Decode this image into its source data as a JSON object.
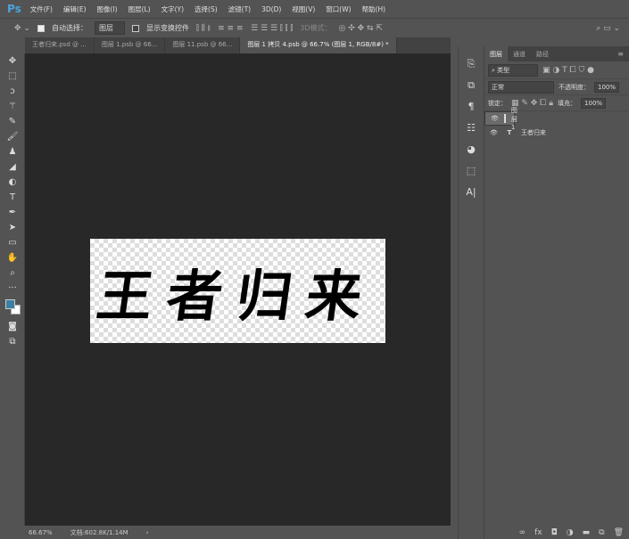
{
  "app": {
    "logo": "Ps"
  },
  "menu": [
    "文件(F)",
    "编辑(E)",
    "图像(I)",
    "图层(L)",
    "文字(Y)",
    "选择(S)",
    "滤镜(T)",
    "3D(D)",
    "视图(V)",
    "窗口(W)",
    "帮助(H)"
  ],
  "options": {
    "auto_select_label": "自动选择：",
    "auto_select_value": "图层",
    "show_transform_label": "显示变换控件",
    "mode_label": "3D模式："
  },
  "tabs": [
    "王者归来.psd @ ...",
    "图层 1.psb @ 66...",
    "图层 11.psb @ 66...",
    "图层 1 拷贝 4.psb @ 66.7% (图层 1, RGB/8#) *"
  ],
  "canvas": {
    "text": "王者归来"
  },
  "status": {
    "zoom": "66.67%",
    "doc": "文档:602.8K/1.14M"
  },
  "panel": {
    "tabs": [
      "图层",
      "通道",
      "路径"
    ],
    "filter": "类型",
    "blend": "正常",
    "opacity_label": "不透明度：",
    "opacity": "100%",
    "lock_label": "锁定：",
    "fill_label": "填充：",
    "fill": "100%",
    "layers": [
      {
        "name": "图层 1",
        "type": "pixel",
        "selected": true
      },
      {
        "name": "王者归来",
        "type": "text",
        "selected": false
      }
    ]
  },
  "colors": {
    "accent": "#4aa3df",
    "canvas_bg": "#282828",
    "ui_bg": "#535353"
  }
}
